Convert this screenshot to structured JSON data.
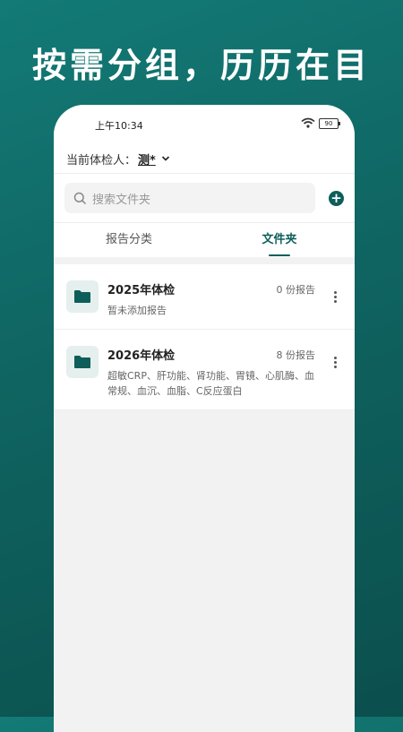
{
  "headline": "按需分组，历历在目",
  "status_bar": {
    "time": "上午10:34",
    "battery": "90"
  },
  "person": {
    "label": "当前体检人：",
    "name": "测*"
  },
  "search": {
    "placeholder": "搜索文件夹"
  },
  "tabs": [
    {
      "label": "报告分类",
      "active": false
    },
    {
      "label": "文件夹",
      "active": true
    }
  ],
  "folders": [
    {
      "title": "2025年体检",
      "count": "0 份报告",
      "desc": "暂未添加报告"
    },
    {
      "title": "2026年体检",
      "count": "8 份报告",
      "desc": "超敏CRP、肝功能、肾功能、胃镜、心肌酶、血常规、血沉、血脂、C反应蛋白"
    }
  ],
  "colors": {
    "accent": "#0d5e5a",
    "background": "#0f6461"
  }
}
